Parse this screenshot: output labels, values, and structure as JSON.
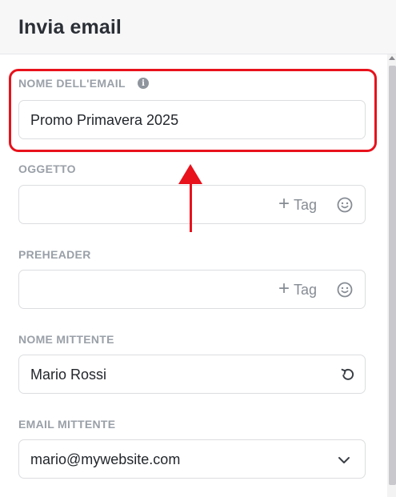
{
  "header": {
    "title": "Invia email"
  },
  "fields": {
    "email_name": {
      "label": "NOME DELL'EMAIL",
      "value": "Promo Primavera 2025"
    },
    "subject": {
      "label": "OGGETTO",
      "value": "",
      "tag_label": "Tag"
    },
    "preheader": {
      "label": "PREHEADER",
      "value": "",
      "tag_label": "Tag"
    },
    "sender_name": {
      "label": "NOME MITTENTE",
      "value": "Mario Rossi"
    },
    "sender_email": {
      "label": "EMAIL MITTENTE",
      "value": "mario@mywebsite.com"
    }
  },
  "icons": {
    "info": "info-icon",
    "plus": "plus-icon",
    "emoji": "emoji-icon",
    "reset": "undo-icon",
    "dropdown": "chevron-down-icon"
  },
  "colors": {
    "highlight": "#e8121c",
    "label": "#9aa0a8",
    "border": "#dcdde0"
  }
}
